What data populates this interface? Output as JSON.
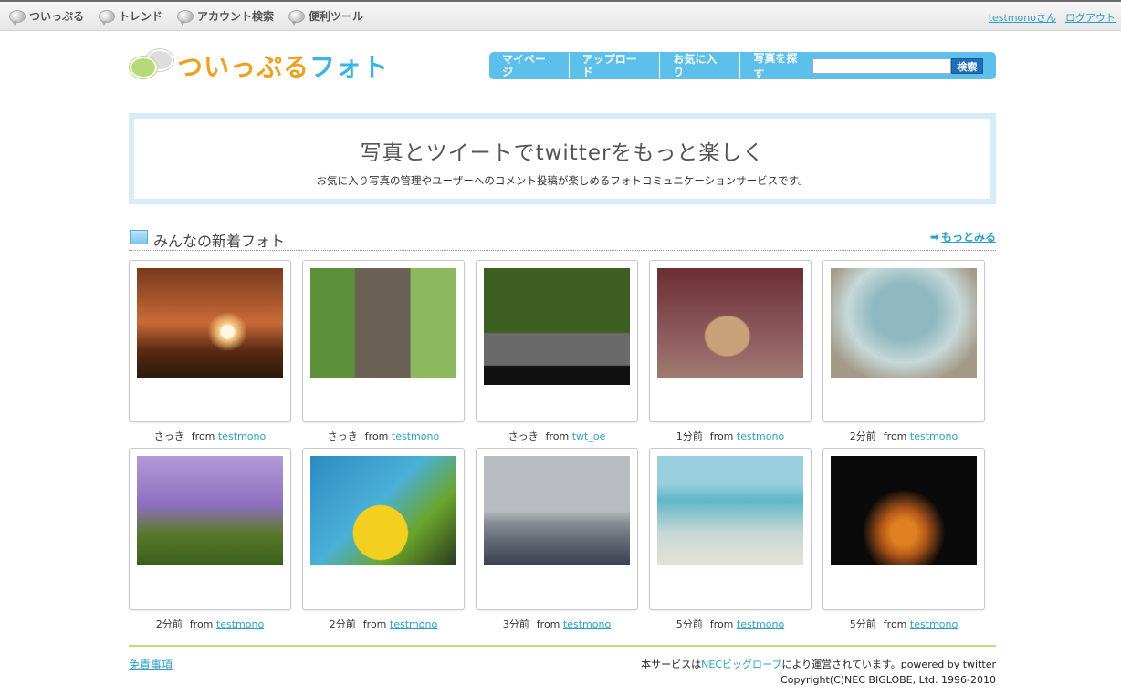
{
  "topnav": {
    "items": [
      {
        "label": "ついっぷる"
      },
      {
        "label": "トレンド"
      },
      {
        "label": "アカウント検索"
      },
      {
        "label": "便利ツール"
      }
    ],
    "user_link": "testmonoさん",
    "logout": "ログアウト"
  },
  "logo": {
    "part_a": "ついっぷる",
    "part_b": "フォト"
  },
  "nav": {
    "mypage": "マイページ",
    "upload": "アップロード",
    "favorites": "お気に入り",
    "search_label": "写真を探す",
    "search_value": "",
    "search_button": "検索"
  },
  "hero": {
    "title": "写真とツイートでtwitterをもっと楽しく",
    "subtitle": "お気に入り写真の管理やユーザーへのコメント投稿が楽しめるフォトコミュニケーションサービスです。"
  },
  "section": {
    "title": "みんなの新着フォト",
    "more": "もっとみる"
  },
  "from_label": "from",
  "photos": [
    {
      "time": "さっき",
      "user": "testmono"
    },
    {
      "time": "さっき",
      "user": "testmono"
    },
    {
      "time": "さっき",
      "user": "twt_oe"
    },
    {
      "time": "1分前",
      "user": "testmono"
    },
    {
      "time": "2分前",
      "user": "testmono"
    },
    {
      "time": "2分前",
      "user": "testmono"
    },
    {
      "time": "2分前",
      "user": "testmono"
    },
    {
      "time": "3分前",
      "user": "testmono"
    },
    {
      "time": "5分前",
      "user": "testmono"
    },
    {
      "time": "5分前",
      "user": "testmono"
    }
  ],
  "footer": {
    "disclaimer": "免責事項",
    "operated_pre": "本サービスは",
    "operated_link": "NECビッグローブ",
    "operated_post": "により運営されています。powered by twitter",
    "copyright": "Copyright(C)NEC BIGLOBE, Ltd. 1996-2010"
  }
}
